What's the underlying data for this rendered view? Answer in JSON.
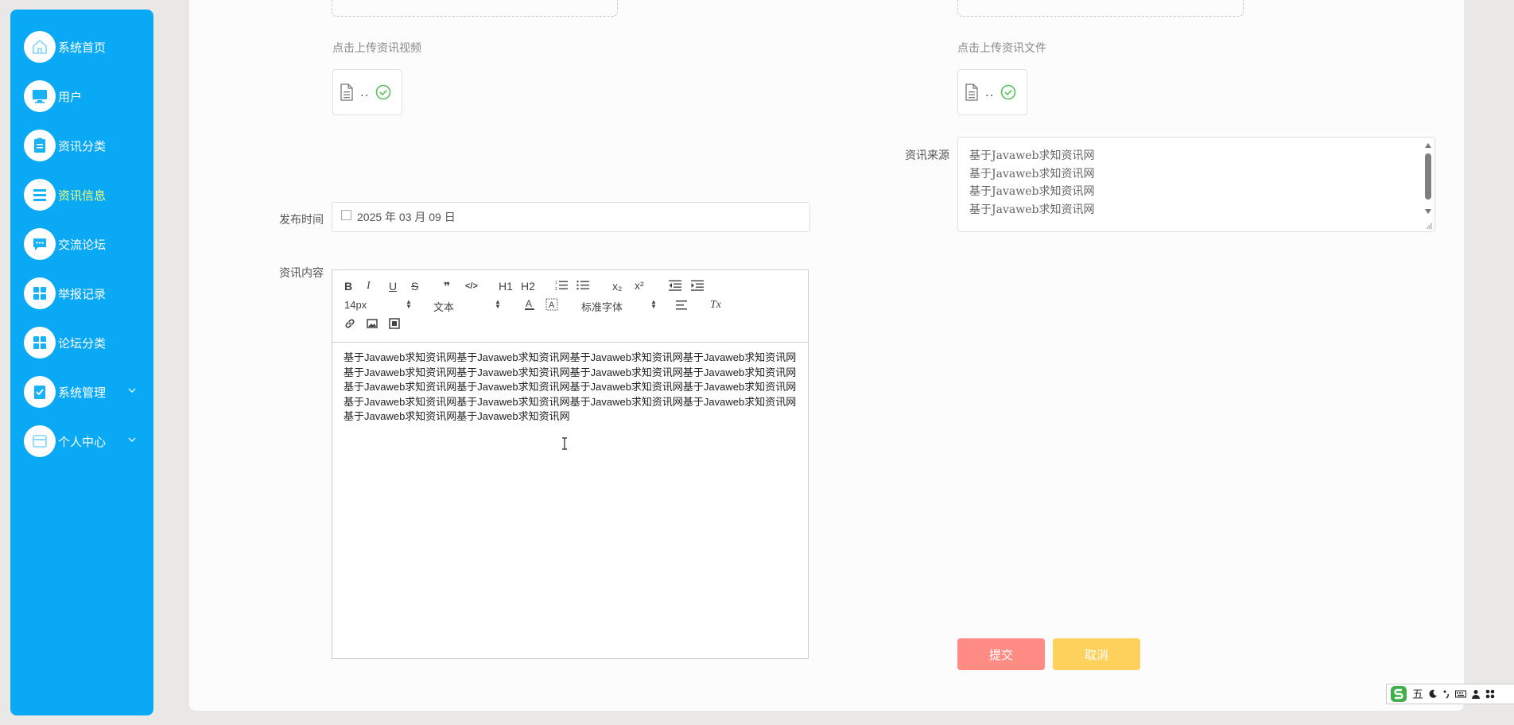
{
  "sidebar": {
    "items": [
      {
        "label": "系统首页",
        "icon": "home-icon"
      },
      {
        "label": "用户",
        "icon": "monitor-icon"
      },
      {
        "label": "资讯分类",
        "icon": "clipboard-icon"
      },
      {
        "label": "资讯信息",
        "icon": "list-icon",
        "active": true
      },
      {
        "label": "交流论坛",
        "icon": "chat-icon"
      },
      {
        "label": "举报记录",
        "icon": "grid-icon"
      },
      {
        "label": "论坛分类",
        "icon": "grid-icon"
      },
      {
        "label": "系统管理",
        "icon": "checklist-icon",
        "expandable": true
      },
      {
        "label": "个人中心",
        "icon": "card-icon",
        "expandable": true
      }
    ]
  },
  "form": {
    "video_upload_caption": "点击上传资讯视频",
    "file_upload_caption": "点击上传资讯文件",
    "file_placeholder": "..",
    "source_label": "资讯来源",
    "source_lines": [
      "基于Javaweb求知资讯网",
      "基于Javaweb求知资讯网",
      "基于Javaweb求知资讯网",
      "基于Javaweb求知资讯网"
    ],
    "publish_time_label": "发布时间",
    "publish_time_value": "2025 年 03 月 09 日",
    "content_label": "资讯内容",
    "content_text": "基于Javaweb求知资讯网基于Javaweb求知资讯网基于Javaweb求知资讯网基于Javaweb求知资讯网基于Javaweb求知资讯网基于Javaweb求知资讯网基于Javaweb求知资讯网基于Javaweb求知资讯网基于Javaweb求知资讯网基于Javaweb求知资讯网基于Javaweb求知资讯网基于Javaweb求知资讯网基于Javaweb求知资讯网基于Javaweb求知资讯网基于Javaweb求知资讯网基于Javaweb求知资讯网基于Javaweb求知资讯网基于Javaweb求知资讯网",
    "submit_label": "提交",
    "cancel_label": "取消"
  },
  "editor_toolbar": {
    "bold": "B",
    "italic": "I",
    "underline": "U",
    "strike": "S",
    "blockquote": "❞",
    "code": "</>",
    "h1": "H1",
    "h2": "H2",
    "sub": "x₂",
    "sup": "x²",
    "size_value": "14px",
    "format_value": "文本",
    "font_value": "标准字体",
    "clear_format": "Tx"
  },
  "ime": {
    "mode": "五"
  },
  "colors": {
    "sidebar_bg": "#0aa9f6",
    "active_label": "#f1ff79",
    "submit_bg": "#fe8b84",
    "cancel_bg": "#fed05c",
    "check_green": "#5ac25a"
  }
}
